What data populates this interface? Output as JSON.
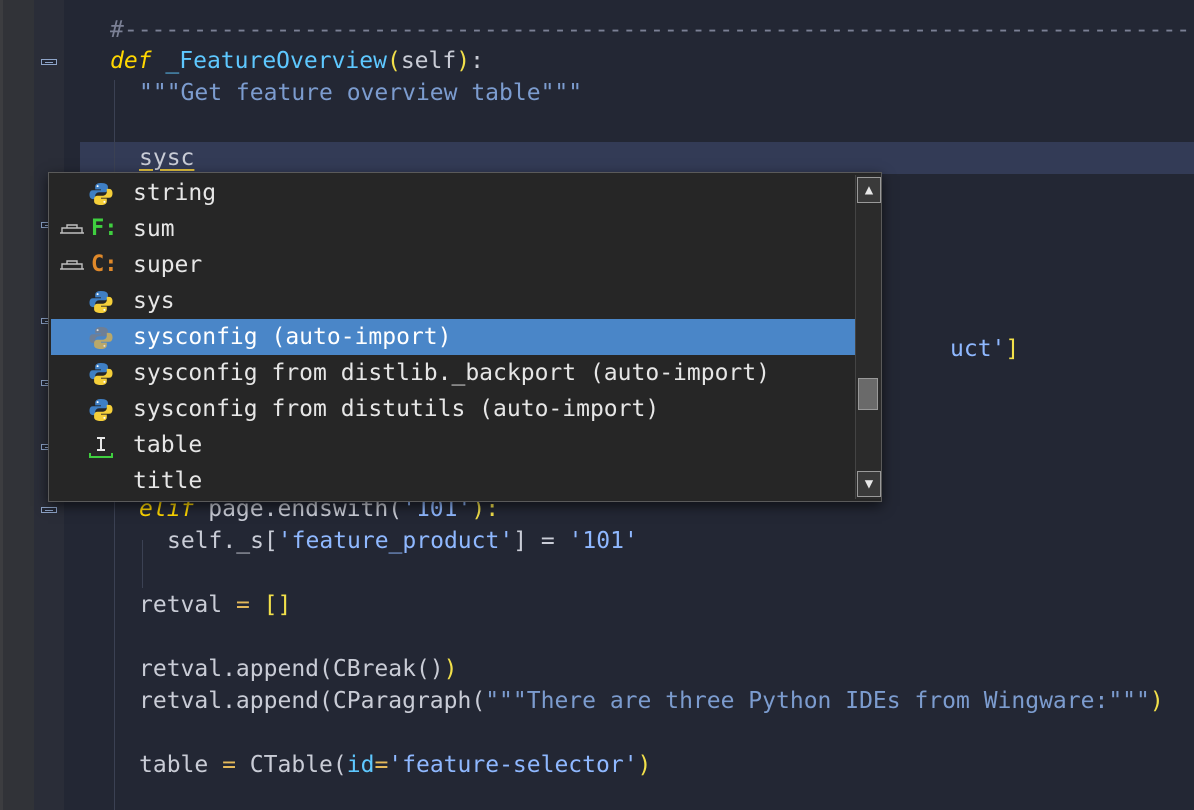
{
  "editor": {
    "lines": {
      "separator": "#-----------------------------------------------------------------------------",
      "def_kw": "def",
      "def_name": "_FeatureOverview",
      "def_open": "(",
      "def_self": "self",
      "def_close": ")",
      "def_colon": ":",
      "docstring": "\"\"\"Get feature overview table\"\"\"",
      "typed": "sysc",
      "partial_right": "uct'",
      "partial_bracket": "]",
      "elif_kw": "elif",
      "elif_expr": " page.endswith(",
      "elif_arg": "'101'",
      "elif_close": "):",
      "assign_lhs": "self._s[",
      "assign_key": "'feature_product'",
      "assign_mid": "] = ",
      "assign_val": "'101'",
      "retval_lhs": "retval ",
      "retval_eq": "=",
      "retval_val": " []",
      "append1_a": "retval.append(",
      "append1_b": "CBreak()",
      "append1_c": ")",
      "append2_a": "retval.append(",
      "append2_b": "CParagraph(",
      "append2_str": "\"\"\"There are three Python IDEs from Wingware:\"\"\"",
      "append2_c": ")",
      "table_lhs": "table ",
      "table_eq": "=",
      "table_call": " CTable(",
      "table_kw": "id",
      "table_eq2": "=",
      "table_str": "'feature-selector'",
      "table_close": ")"
    }
  },
  "autocomplete": {
    "items": [
      {
        "label": "string",
        "icon": "python-module-icon",
        "kind": ""
      },
      {
        "label": "sum",
        "icon": "function-icon",
        "kind": "F:"
      },
      {
        "label": "super",
        "icon": "class-icon",
        "kind": "C:"
      },
      {
        "label": "sys",
        "icon": "python-module-icon",
        "kind": ""
      },
      {
        "label": "sysconfig (auto-import)",
        "icon": "python-module-icon",
        "kind": "",
        "selected": true
      },
      {
        "label": "sysconfig from distlib._backport (auto-import)",
        "icon": "python-module-icon",
        "kind": ""
      },
      {
        "label": "sysconfig from distutils (auto-import)",
        "icon": "python-module-icon",
        "kind": ""
      },
      {
        "label": "table",
        "icon": "text-cursor-icon",
        "kind": ""
      },
      {
        "label": "title",
        "icon": "",
        "kind": ""
      }
    ],
    "scroll_position": 0.75
  },
  "colors": {
    "background": "#232734",
    "current_line": "#333b56",
    "selection": "#4a86c8",
    "keyword": "#ffd700",
    "function_name": "#5ec8ff",
    "string": "#7c9ccf",
    "function_kind": "#3fcf3f",
    "class_kind": "#e0892a"
  }
}
